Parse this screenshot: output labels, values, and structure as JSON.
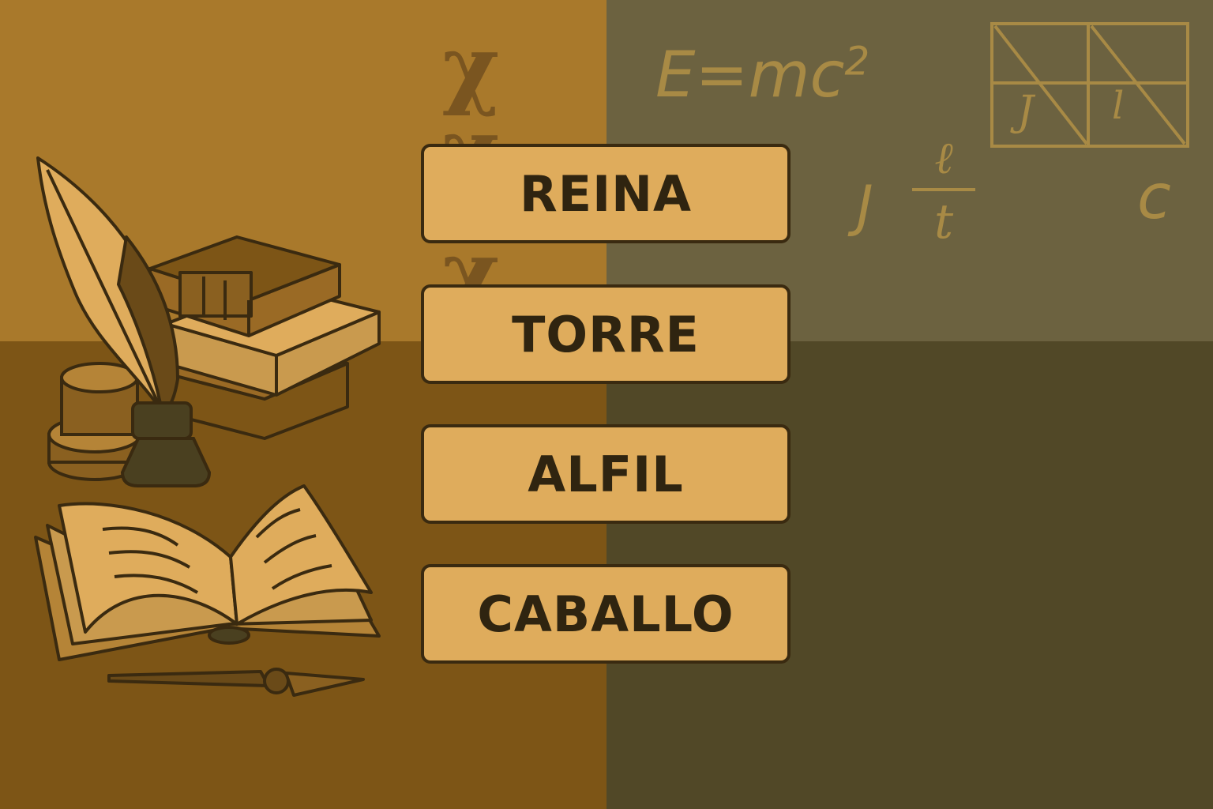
{
  "options": [
    "REINA",
    "TORRE",
    "ALFIL",
    "CABALLO"
  ],
  "formula": {
    "main": "E=mc",
    "exponent": "2",
    "j_left": "J",
    "frac_num": "ℓ",
    "frac_den": "t",
    "c": "c",
    "box_left": "J",
    "box_right": "l"
  },
  "chi_glyph": "χ",
  "icons": [
    "quill-icon",
    "book-stack-icon",
    "inkwell-icon",
    "coin-stack-icon",
    "open-book-icon",
    "pen-icon",
    "diagram-grid-icon"
  ]
}
